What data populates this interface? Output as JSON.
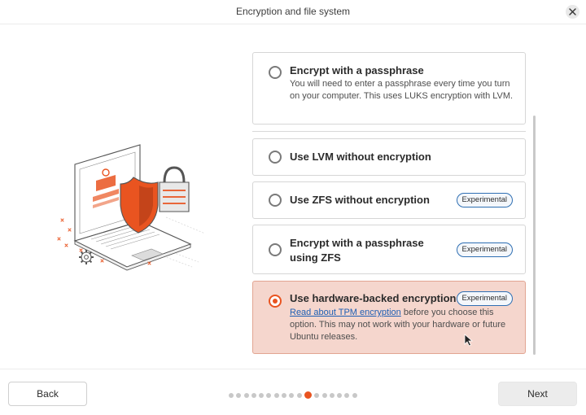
{
  "window": {
    "title": "Encryption and file system"
  },
  "options": [
    {
      "label": "Encrypt with a passphrase",
      "description": "You will need to enter a passphrase every time you turn on your computer. This uses LUKS encryption with LVM.",
      "selected": false
    },
    {
      "label": "Use LVM without encryption",
      "selected": false
    },
    {
      "label": "Use ZFS without encryption",
      "badge": "Experimental",
      "selected": false
    },
    {
      "label": "Encrypt with a passphrase using ZFS",
      "badge": "Experimental",
      "selected": false
    },
    {
      "label": "Use hardware-backed encryption",
      "badge": "Experimental",
      "link_text": "Read about TPM encryption",
      "description_after_link": " before you choose this option. This may not work with your hardware or future Ubuntu releases.",
      "selected": true
    }
  ],
  "footer": {
    "back_label": "Back",
    "next_label": "Next",
    "progress": {
      "total_steps": 17,
      "current_step": 11
    }
  },
  "colors": {
    "accent": "#e95420",
    "selected_bg": "#f5d6cd",
    "link": "#1d5fb4",
    "badge_border": "#2f6fb3"
  },
  "icons": [
    "close-icon",
    "laptop-shield-illustration",
    "mouse-pointer-icon"
  ]
}
